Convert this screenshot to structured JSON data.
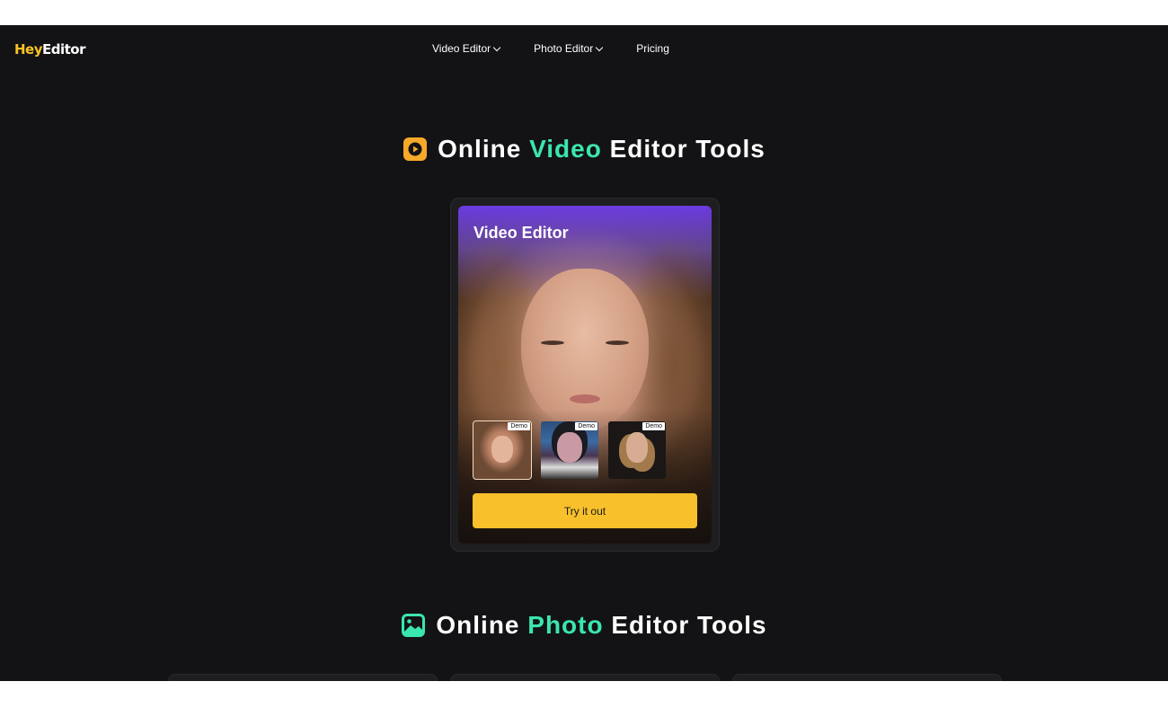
{
  "header": {
    "logo_hey": "Hey",
    "logo_editor": "Editor",
    "nav": [
      {
        "label": "Video Editor",
        "dropdown": true
      },
      {
        "label": "Photo Editor",
        "dropdown": true
      },
      {
        "label": "Pricing",
        "dropdown": false
      }
    ]
  },
  "video_section": {
    "title_pre": "Online ",
    "title_accent": "Video",
    "title_post": " Editor Tools",
    "icon": "play-icon",
    "icon_color": "#f7a929",
    "accent_color": "#3be6ad",
    "card": {
      "title": "Video Editor",
      "thumbnails": [
        {
          "badge": "Demo",
          "selected": true
        },
        {
          "badge": "Demo",
          "selected": false
        },
        {
          "badge": "Demo",
          "selected": false
        }
      ],
      "cta": "Try it out",
      "cta_color": "#f8c02b"
    }
  },
  "photo_section": {
    "title_pre": "Online ",
    "title_accent": "Photo",
    "title_post": " Editor Tools",
    "icon": "image-icon",
    "icon_color": "#3be6ad",
    "card_accents": [
      "#e0413f",
      "#36c890",
      "#e0413f"
    ]
  }
}
